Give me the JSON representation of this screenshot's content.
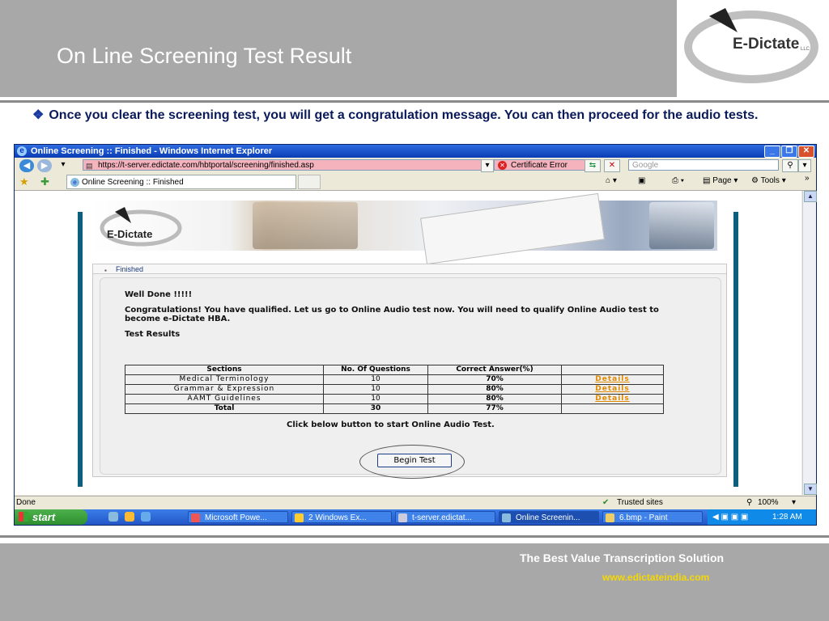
{
  "slide": {
    "title": "On Line Screening Test Result",
    "bullet_icon": "❖",
    "bullet_text": "Once you clear the screening test, you will get a congratulation message. You can then proceed for the audio tests.",
    "logo_text": "E-Dictate",
    "logo_llc": "LLC",
    "footer_tagline": "The Best Value Transcription Solution",
    "footer_url": "www.edictateindia.com"
  },
  "browser": {
    "title": "Online Screening :: Finished - Windows Internet Explorer",
    "address": "https://t-server.edictate.com/hbtportal/screening/finished.asp",
    "cert_error": "Certificate Error",
    "search_placeholder": "Google",
    "tab_label": "Online Screening :: Finished",
    "cmd_page": "Page",
    "cmd_tools": "Tools",
    "status_text": "Done",
    "zone_text": "Trusted sites",
    "zoom_text": "100%"
  },
  "taskbar": {
    "start_label": "start",
    "items": [
      {
        "label": "Microsoft Powe..."
      },
      {
        "label": "2 Windows Ex..."
      },
      {
        "label": "t-server.edictat..."
      },
      {
        "label": "Online Screenin..."
      },
      {
        "label": "6.bmp - Paint"
      }
    ],
    "clock": "1:28 AM"
  },
  "page": {
    "banner_logo": "E-Dictate",
    "panel_header": "Finished",
    "well_done": "Well Done !!!!!",
    "congrats": "Congratulations! You have qualified. Let us go to Online Audio test now. You will need to qualify Online Audio test to become e-Dictate HBA.",
    "results_heading": "Test Results",
    "table": {
      "headers": [
        "Sections",
        "No. Of Questions",
        "Correct Answer(%)",
        ""
      ],
      "rows": [
        {
          "section": "Medical Terminology",
          "questions": "10",
          "correct": "70%",
          "link": "Details"
        },
        {
          "section": "Grammar & Expression",
          "questions": "10",
          "correct": "80%",
          "link": "Details"
        },
        {
          "section": "AAMT Guidelines",
          "questions": "10",
          "correct": "80%",
          "link": "Details"
        }
      ],
      "total": {
        "label": "Total",
        "questions": "30",
        "correct": "77%"
      }
    },
    "click_below": "Click below button to start Online Audio Test.",
    "begin_button": "Begin Test"
  },
  "colors": {
    "header_gray": "#a8a8a8",
    "bullet_navy": "#0a1a5a",
    "details_orange": "#e08a00",
    "footer_url_yellow": "#f5d800"
  }
}
